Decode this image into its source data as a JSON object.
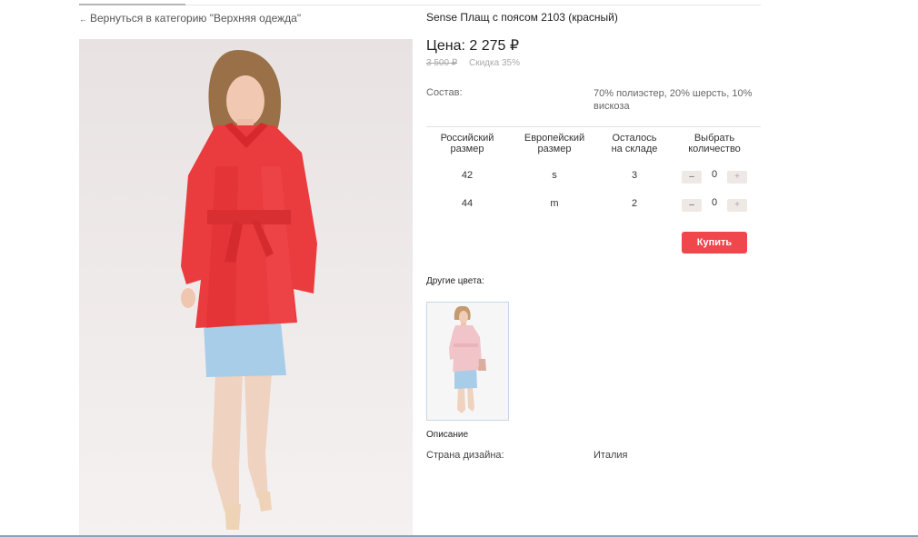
{
  "nav": {
    "back_arrow": "←",
    "back_label": "Вернуться в категорию \"Верхняя одежда\""
  },
  "product": {
    "title": "Sense Плащ с поясом 2103 (красный)",
    "price": "Цена: 2 275 ₽",
    "old_price": "3 500 ₽",
    "discount": "Скидка 35%",
    "composition_label": "Состав:",
    "composition_value": "70% полиэстер, 20% шерсть, 10% вискоза"
  },
  "size_table": {
    "headers": [
      {
        "line1": "Российский",
        "line2": "размер"
      },
      {
        "line1": "Европейский",
        "line2": "размер"
      },
      {
        "line1": "Осталось",
        "line2": "на складе"
      },
      {
        "line1": "Выбрать",
        "line2": "количество"
      }
    ],
    "rows": [
      {
        "ru_size": "42",
        "eu_size": "s",
        "stock": "3",
        "qty": "0"
      },
      {
        "ru_size": "44",
        "eu_size": "m",
        "stock": "2",
        "qty": "0"
      }
    ],
    "minus_label": "–",
    "plus_label": "+"
  },
  "buy_button": "Купить",
  "other_colors": {
    "label": "Другие цвета:"
  },
  "description": {
    "title": "Описание",
    "country_label": "Страна дизайна:",
    "country_value": "Италия"
  },
  "colors": {
    "accent": "#f0474d",
    "coat_main": "#ea3b3e",
    "skirt": "#a8cde9",
    "thumb_coat": "#f1c4c9"
  }
}
